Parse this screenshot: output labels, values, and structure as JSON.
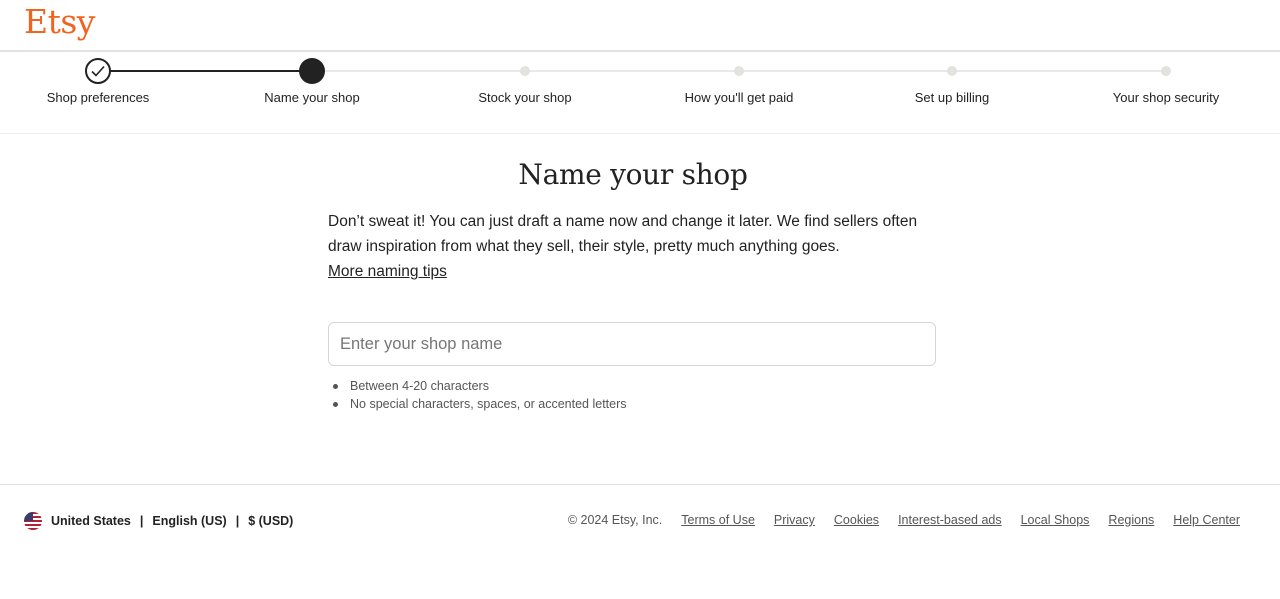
{
  "header": {
    "logo": "Etsy"
  },
  "steps": [
    {
      "label": "Shop preferences",
      "state": "done"
    },
    {
      "label": "Name your shop",
      "state": "current"
    },
    {
      "label": "Stock your shop",
      "state": "todo"
    },
    {
      "label": "How you'll get paid",
      "state": "todo"
    },
    {
      "label": "Set up billing",
      "state": "todo"
    },
    {
      "label": "Your shop security",
      "state": "todo"
    }
  ],
  "main": {
    "title": "Name your shop",
    "description": "Don’t sweat it! You can just draft a name now and change it later. We find sellers often draw inspiration from what they sell, their style, pretty much anything goes.",
    "tips_link": "More naming tips",
    "shop_name_input": {
      "value": "",
      "placeholder": "Enter your shop name"
    },
    "rules": [
      "Between 4-20 characters",
      "No special characters, spaces, or accented letters"
    ]
  },
  "footer": {
    "country": "United States",
    "language": "English (US)",
    "currency": "$ (USD)",
    "separator": "|",
    "copyright": "© 2024 Etsy, Inc.",
    "links": [
      "Terms of Use",
      "Privacy",
      "Cookies",
      "Interest-based ads",
      "Local Shops",
      "Regions",
      "Help Center"
    ]
  },
  "colors": {
    "brand": "#f1641e",
    "progress": "#222222",
    "inactive": "#e1e3df"
  }
}
